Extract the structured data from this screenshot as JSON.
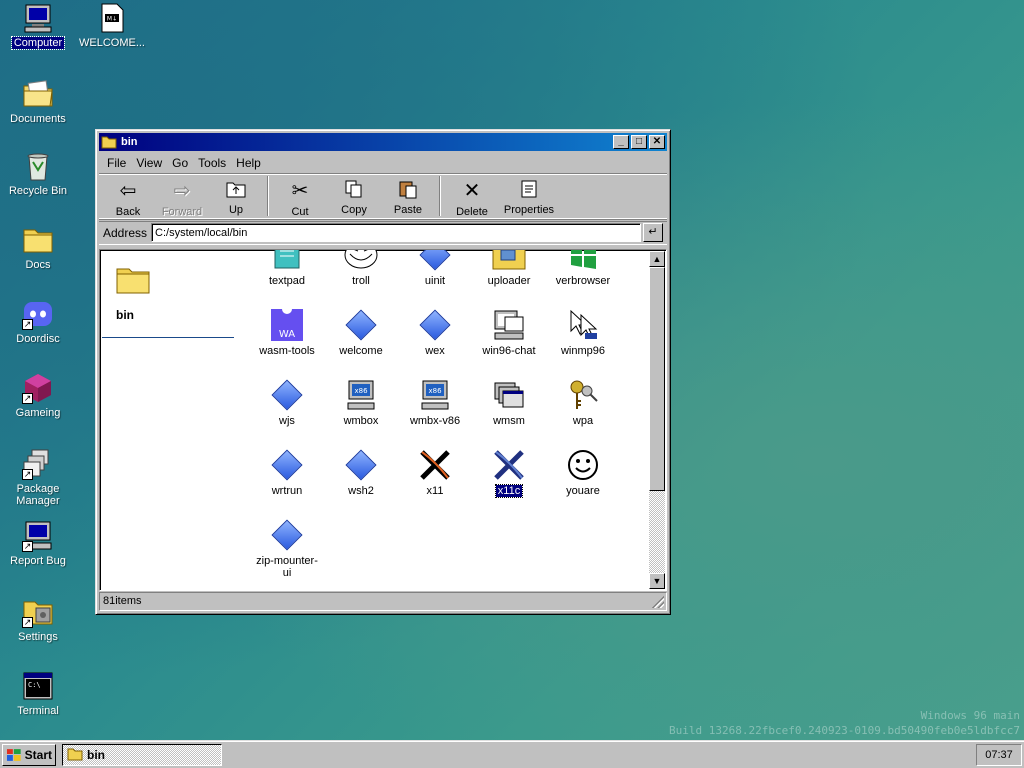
{
  "desktop": {
    "icons": [
      {
        "label": "Computer",
        "icon": "computer-icon",
        "selected": true
      },
      {
        "label": "WELCOME...",
        "icon": "markdown-file-icon"
      },
      {
        "label": "Documents",
        "icon": "documents-folder-icon"
      },
      {
        "label": "Recycle Bin",
        "icon": "recycle-bin-icon"
      },
      {
        "label": "Docs",
        "icon": "folder-icon"
      },
      {
        "label": "Doordisc",
        "icon": "discord-icon"
      },
      {
        "label": "Gameing",
        "icon": "game-cube-icon"
      },
      {
        "label": "Package Manager",
        "icon": "package-icon"
      },
      {
        "label": "Report Bug",
        "icon": "report-bug-icon"
      },
      {
        "label": "Settings",
        "icon": "settings-folder-icon"
      },
      {
        "label": "Terminal",
        "icon": "terminal-icon"
      }
    ],
    "watermark_line1": "Windows 96 main",
    "watermark_line2": "Build 13268.22fbcef0.240923-0109.bd50490feb0e5ldbfcc7"
  },
  "window": {
    "title": "bin",
    "menu": [
      "File",
      "View",
      "Go",
      "Tools",
      "Help"
    ],
    "toolbar": {
      "back": "Back",
      "forward": "Forward",
      "up": "Up",
      "cut": "Cut",
      "copy": "Copy",
      "paste": "Paste",
      "delete": "Delete",
      "properties": "Properties"
    },
    "address_label": "Address",
    "address_value": "C:/system/local/bin",
    "side_title": "bin",
    "files": [
      {
        "label": "textpad",
        "icon": "textpad-icon"
      },
      {
        "label": "troll",
        "icon": "trollface-icon"
      },
      {
        "label": "uinit",
        "icon": "diamond-icon"
      },
      {
        "label": "uploader",
        "icon": "uploader-icon"
      },
      {
        "label": "verbrowser",
        "icon": "windows-flag-icon"
      },
      {
        "label": "wasm-tools",
        "icon": "wasm-icon"
      },
      {
        "label": "welcome",
        "icon": "diamond-icon"
      },
      {
        "label": "wex",
        "icon": "diamond-icon"
      },
      {
        "label": "win96-chat",
        "icon": "chat-computer-icon"
      },
      {
        "label": "winmp96",
        "icon": "media-player-icon"
      },
      {
        "label": "wjs",
        "icon": "diamond-icon"
      },
      {
        "label": "wmbox",
        "icon": "x86-computer-icon"
      },
      {
        "label": "wmbx-v86",
        "icon": "x86-computer-icon"
      },
      {
        "label": "wmsm",
        "icon": "window-stack-icon"
      },
      {
        "label": "wpa",
        "icon": "keys-icon"
      },
      {
        "label": "wrtrun",
        "icon": "diamond-icon"
      },
      {
        "label": "wsh2",
        "icon": "diamond-icon"
      },
      {
        "label": "x11",
        "icon": "x11-icon"
      },
      {
        "label": "x11c",
        "icon": "x11c-icon",
        "selected": true
      },
      {
        "label": "youare",
        "icon": "smiley-icon"
      },
      {
        "label": "zip-mounter-ui",
        "icon": "diamond-icon"
      }
    ],
    "status": "81items"
  },
  "taskbar": {
    "start_label": "Start",
    "task_label": "bin",
    "clock": "07:37"
  }
}
